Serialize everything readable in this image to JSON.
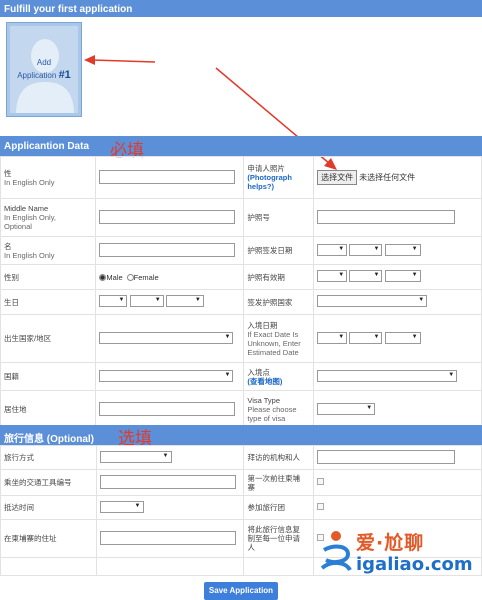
{
  "header": {
    "title": "Fulfill your first application"
  },
  "avatar": {
    "add_label": "Add",
    "application_label": "Application",
    "number": "#1"
  },
  "sections": {
    "app_data": {
      "title": "Applicantion Data",
      "note": "必填"
    },
    "travel": {
      "title": "旅行信息 (Optional)",
      "note": "选填"
    }
  },
  "app_rows": {
    "surname": {
      "label": "性",
      "sub": "In English Only"
    },
    "middle": {
      "label": "Middle Name",
      "sub1": "In English Only,",
      "sub2": "Optional"
    },
    "given": {
      "label": "名",
      "sub": "In English Only"
    },
    "gender": {
      "label": "性别",
      "male": "Male",
      "female": "Female"
    },
    "birthday": {
      "label": "生日"
    },
    "birth_country": {
      "label": "出生国家/地区"
    },
    "nationality": {
      "label": "国籍"
    },
    "residence": {
      "label": "居住地"
    },
    "photo": {
      "label": "申请人照片",
      "help": "(Photograph helps?)",
      "button": "选择文件",
      "status": "未选择任何文件"
    },
    "passport_no": {
      "label": "护照号"
    },
    "passport_issue": {
      "label": "护照签发日期"
    },
    "passport_expiry": {
      "label": "护照有效期"
    },
    "issuing_country": {
      "label": "签发护照国家"
    },
    "entry_date": {
      "label": "入境日期",
      "sub1": "If Exact Date Is",
      "sub2": "Unknown, Enter",
      "sub3": "Estimated Date"
    },
    "entry_point": {
      "label": "入境点",
      "link": "(查看地图)"
    },
    "visa_type": {
      "label": "Visa Type",
      "sub1": "Please choose",
      "sub2": "type of visa"
    }
  },
  "travel_rows": {
    "mode": {
      "label": "旅行方式"
    },
    "vehicle_no": {
      "label": "乘坐的交通工具编号"
    },
    "arrival_time": {
      "label": "抵达时间"
    },
    "address": {
      "label": "在柬埔寨的住址"
    },
    "contact": {
      "label": "拜访的机构和人"
    },
    "first_visit": {
      "label": "第一次前往柬埔",
      "label2": "寨"
    },
    "tour_group": {
      "label": "参加旅行团"
    },
    "copy_info": {
      "label": "将此旅行信息复",
      "label2": "制至每一位申请",
      "label3": "人"
    }
  },
  "actions": {
    "save": "Save Application"
  },
  "watermark": {
    "brand": "爱·尬聊",
    "url": "igaliao.com"
  },
  "colors": {
    "bar": "#5b8fd8",
    "note_red": "#e23a2a",
    "button": "#3f7fdc"
  }
}
